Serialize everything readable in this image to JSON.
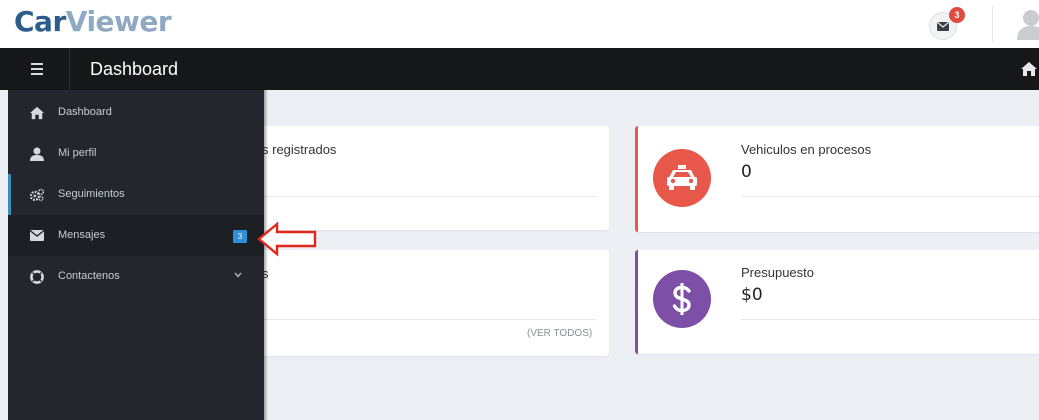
{
  "brand": {
    "part1": "Car",
    "part2": "Viewer"
  },
  "header": {
    "mail_count": "3",
    "page_title": "Dashboard"
  },
  "sidebar": {
    "items": [
      {
        "label": "Dashboard",
        "icon": "home-icon"
      },
      {
        "label": "Mi perfil",
        "icon": "user-icon"
      },
      {
        "label": "Seguimientos",
        "icon": "cogs-icon"
      },
      {
        "label": "Mensajes",
        "icon": "envelope-icon",
        "badge": "3"
      },
      {
        "label": "Contactenos",
        "icon": "lifebuoy-icon"
      }
    ]
  },
  "cards": [
    {
      "title": "s registrados"
    },
    {
      "title": "Vehiculos en procesos",
      "value": "0",
      "color": "#e8584a"
    },
    {
      "title": "s",
      "link": "(VER TODOS)"
    },
    {
      "title": "Presupuesto",
      "value": "$0",
      "color": "#7d4fa6"
    }
  ],
  "colors": {
    "accent": "#3c8dbc",
    "red": "#e04b3f",
    "purple": "#7d4fa6"
  }
}
